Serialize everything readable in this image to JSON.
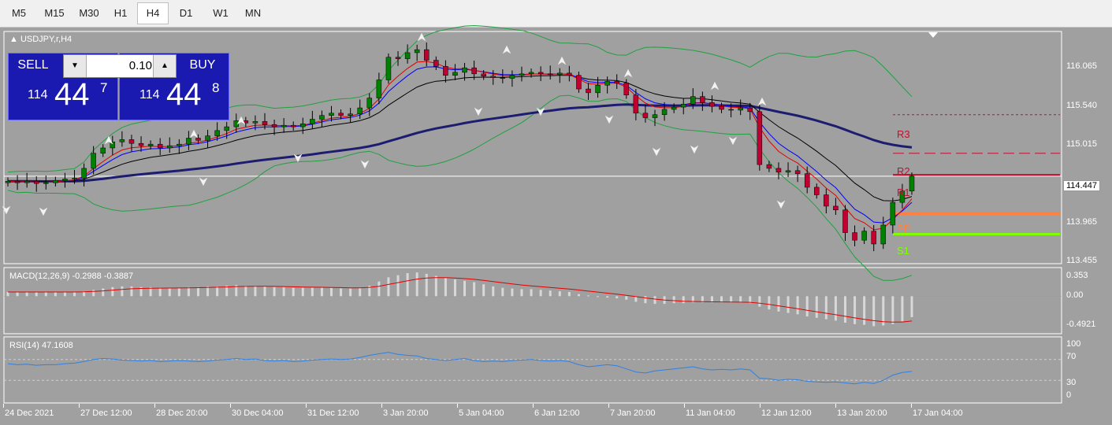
{
  "timeframes": [
    "M5",
    "M15",
    "M30",
    "H1",
    "H4",
    "D1",
    "W1",
    "MN"
  ],
  "active_timeframe": "H4",
  "symbol_title": "USDJPY,r,H4",
  "trade": {
    "sell_label": "SELL",
    "buy_label": "BUY",
    "lot": "0.10",
    "sell_big": "114",
    "sell_pips": "44",
    "sell_frac": "7",
    "buy_big": "114",
    "buy_pips": "44",
    "buy_frac": "8"
  },
  "price_axis": [
    "116.065",
    "115.540",
    "115.015",
    "114.447",
    "113.965",
    "113.455"
  ],
  "current_price": "114.447",
  "pivots": {
    "r3": "R3",
    "r2": "R2",
    "r1": "R1",
    "pp": "PP",
    "s1": "S1"
  },
  "macd": {
    "title": "MACD(12,26,9) -0.2988 -0.3887",
    "axis": [
      "0.353",
      "0.00",
      "-0.4921"
    ]
  },
  "rsi": {
    "title": "RSI(14) 47.1608",
    "axis": [
      "100",
      "70",
      "30",
      "0"
    ]
  },
  "time_axis": [
    "24 Dec 2021",
    "27 Dec 12:00",
    "28 Dec 20:00",
    "30 Dec 04:00",
    "31 Dec 12:00",
    "3 Jan 20:00",
    "5 Jan 04:00",
    "6 Jan 12:00",
    "7 Jan 20:00",
    "11 Jan 04:00",
    "12 Jan 12:00",
    "13 Jan 20:00",
    "17 Jan 04:00"
  ],
  "colors": {
    "background": "#a0a0a0",
    "bull_candle": "#008000",
    "bear_candle": "#c00030",
    "ma_red": "#e00000",
    "ma_blue": "#0000ff",
    "ma_black": "#000000",
    "ma_slow": "#1c1c70",
    "bollinger": "#20a040",
    "rsi_line": "#3080e0",
    "r_levels": "#c01030",
    "pp": "#ff8040",
    "s1": "#80ff00"
  },
  "chart_data": {
    "type": "candlestick",
    "symbol": "USDJPY,r",
    "timeframe": "H4",
    "ylim": [
      113.3,
      116.35
    ],
    "current_price": 114.447,
    "pivots": {
      "R3": 115.26,
      "R2": 114.75,
      "R1": 114.46,
      "PP": 113.95,
      "S1": 113.68
    },
    "close": [
      114.38,
      114.36,
      114.38,
      114.35,
      114.36,
      114.39,
      114.41,
      114.42,
      114.55,
      114.75,
      114.82,
      114.9,
      114.93,
      114.88,
      114.85,
      114.87,
      114.82,
      114.85,
      114.87,
      114.95,
      114.92,
      114.98,
      115.05,
      115.1,
      115.18,
      115.15,
      115.17,
      115.13,
      115.1,
      115.12,
      115.1,
      115.14,
      115.2,
      115.25,
      115.28,
      115.25,
      115.27,
      115.35,
      115.48,
      115.72,
      116.02,
      116.0,
      116.08,
      116.12,
      115.98,
      115.9,
      115.78,
      115.82,
      115.88,
      115.8,
      115.77,
      115.75,
      115.74,
      115.78,
      115.8,
      115.82,
      115.8,
      115.79,
      115.81,
      115.78,
      115.6,
      115.55,
      115.65,
      115.7,
      115.68,
      115.52,
      115.28,
      115.22,
      115.26,
      115.33,
      115.36,
      115.4,
      115.5,
      115.42,
      115.37,
      115.33,
      115.32,
      115.35,
      115.3,
      114.6,
      114.55,
      114.5,
      114.52,
      114.48,
      114.3,
      114.2,
      114.05,
      114.0,
      113.7,
      113.6,
      113.72,
      113.55,
      113.8,
      114.1,
      114.25,
      114.447
    ],
    "macd_hist": [
      0.06,
      0.06,
      0.06,
      0.06,
      0.06,
      0.06,
      0.06,
      0.06,
      0.07,
      0.09,
      0.11,
      0.13,
      0.14,
      0.14,
      0.13,
      0.13,
      0.12,
      0.12,
      0.12,
      0.13,
      0.13,
      0.14,
      0.14,
      0.15,
      0.16,
      0.15,
      0.15,
      0.14,
      0.13,
      0.13,
      0.12,
      0.12,
      0.12,
      0.12,
      0.12,
      0.11,
      0.11,
      0.12,
      0.15,
      0.21,
      0.27,
      0.3,
      0.33,
      0.34,
      0.32,
      0.29,
      0.26,
      0.24,
      0.22,
      0.2,
      0.17,
      0.14,
      0.12,
      0.11,
      0.1,
      0.1,
      0.09,
      0.08,
      0.07,
      0.06,
      0.03,
      0.01,
      0.0,
      -0.02,
      -0.03,
      -0.05,
      -0.08,
      -0.1,
      -0.11,
      -0.11,
      -0.1,
      -0.1,
      -0.09,
      -0.09,
      -0.09,
      -0.09,
      -0.09,
      -0.09,
      -0.1,
      -0.15,
      -0.19,
      -0.22,
      -0.24,
      -0.26,
      -0.29,
      -0.31,
      -0.33,
      -0.35,
      -0.38,
      -0.4,
      -0.41,
      -0.43,
      -0.42,
      -0.4,
      -0.36,
      -0.3
    ],
    "rsi": [
      62,
      60,
      61,
      59,
      60,
      60,
      62,
      63,
      66,
      70,
      72,
      71,
      69,
      68,
      67,
      68,
      66,
      67,
      68,
      67,
      66,
      67,
      69,
      70,
      72,
      70,
      71,
      68,
      67,
      68,
      66,
      67,
      69,
      70,
      71,
      70,
      71,
      74,
      78,
      81,
      84,
      80,
      78,
      77,
      72,
      70,
      68,
      70,
      72,
      68,
      66,
      67,
      66,
      68,
      69,
      70,
      68,
      67,
      68,
      66,
      60,
      56,
      58,
      60,
      58,
      52,
      46,
      44,
      48,
      50,
      52,
      54,
      56,
      52,
      50,
      51,
      50,
      52,
      50,
      34,
      33,
      30,
      32,
      31,
      28,
      27,
      26,
      27,
      25,
      23,
      26,
      24,
      30,
      40,
      45,
      47.16
    ]
  }
}
